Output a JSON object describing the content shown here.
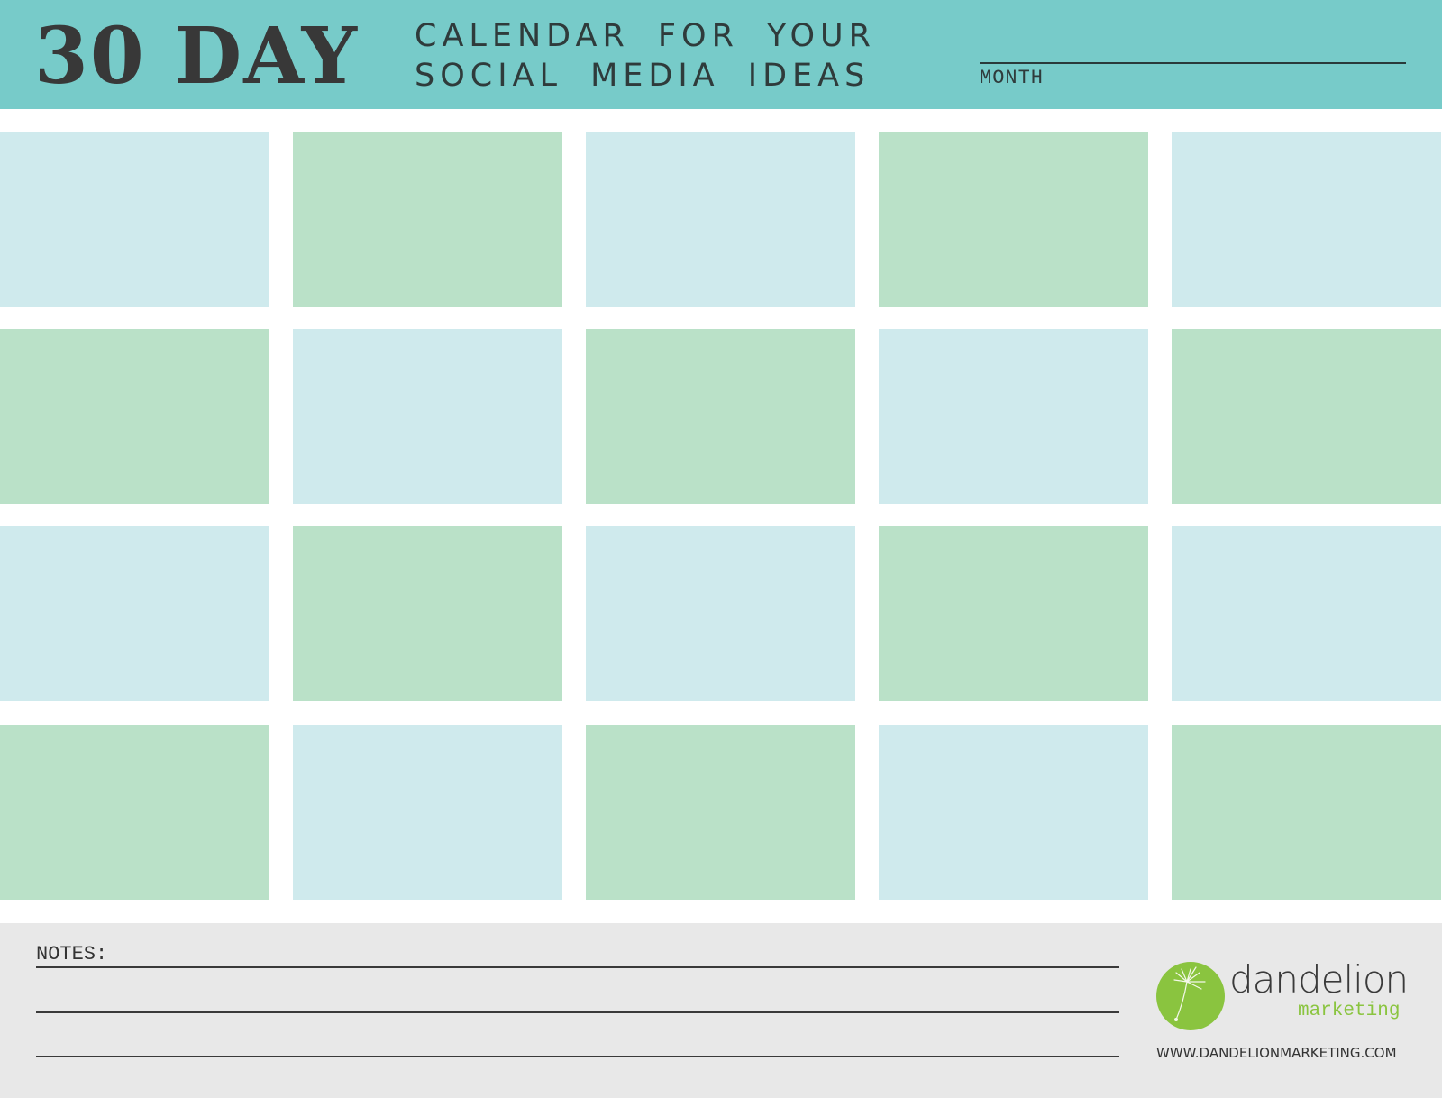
{
  "header": {
    "title": "30 DAY",
    "subtitle_line1": "CALENDAR FOR YOUR",
    "subtitle_line2": "SOCIAL MEDIA IDEAS",
    "month_label": "MONTH",
    "background_color": "#77cbc9"
  },
  "calendar": {
    "rows": 4,
    "columns": 5,
    "cells": [
      "blue",
      "green",
      "blue",
      "green",
      "blue",
      "green",
      "blue",
      "green",
      "blue",
      "green",
      "blue",
      "green",
      "blue",
      "green",
      "blue",
      "green",
      "blue",
      "green",
      "blue",
      "green"
    ],
    "colors": {
      "blue": "#cfeaed",
      "green": "#bae1c8"
    }
  },
  "footer": {
    "notes_label": "NOTES:",
    "note_lines": 3,
    "logo": {
      "name": "dandelion",
      "sub": "marketing",
      "accent_color": "#8ac43f"
    },
    "website": "WWW.DANDELIONMARKETING.COM"
  }
}
